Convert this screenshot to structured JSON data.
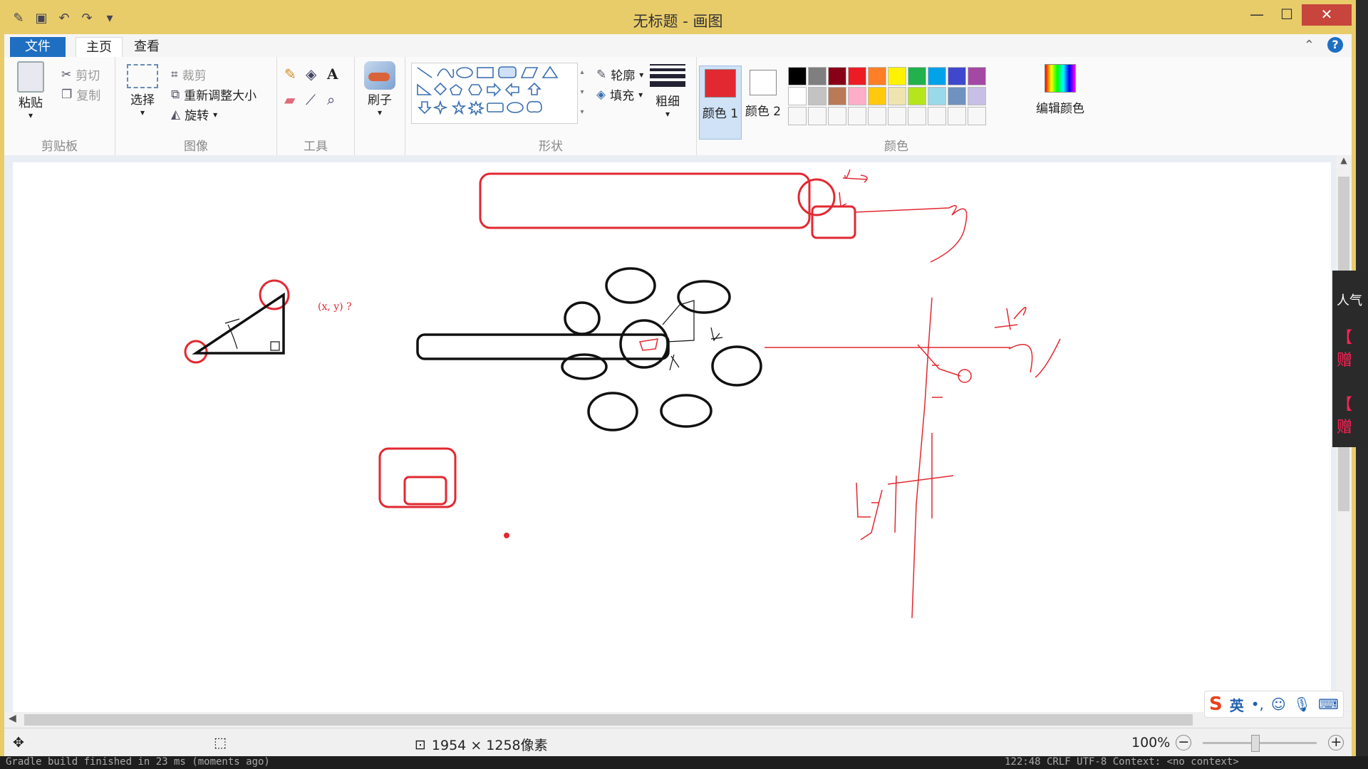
{
  "window": {
    "title": "无标题 - 画图"
  },
  "tabs": {
    "file": "文件",
    "home": "主页",
    "view": "查看"
  },
  "ribbon": {
    "clipboard": {
      "paste": "粘贴",
      "cut": "剪切",
      "copy": "复制",
      "label": "剪贴板"
    },
    "image": {
      "select": "选择",
      "crop": "裁剪",
      "resize": "重新调整大小",
      "rotate": "旋转",
      "label": "图像"
    },
    "tools": {
      "label": "工具",
      "text_tool": "A"
    },
    "brush": {
      "label": "刷子"
    },
    "shapes": {
      "outline": "轮廓",
      "fill": "填充",
      "label": "形状"
    },
    "size": {
      "label": "粗细"
    },
    "colors": {
      "color1": "颜色 1",
      "color2": "颜色 2",
      "edit": "编辑颜色",
      "label": "颜色",
      "color1_value": "#e22831",
      "color2_value": "#ffffff",
      "palette_row1": [
        "#000000",
        "#7f7f7f",
        "#880015",
        "#ed1c24",
        "#ff7f27",
        "#fff200",
        "#22b14c",
        "#00a2e8",
        "#3f48cc",
        "#a349a4"
      ],
      "palette_row2": [
        "#ffffff",
        "#c3c3c3",
        "#b97a57",
        "#ffaec9",
        "#ffc90e",
        "#efe4b0",
        "#b5e61d",
        "#99d9ea",
        "#7092be",
        "#c8bfe7"
      ]
    }
  },
  "canvas": {
    "annotation": "(x, y) ?"
  },
  "status": {
    "dimensions": "1954 × 1258像素",
    "zoom": "100%"
  },
  "side_panel": {
    "line1": "人气",
    "line2": "【",
    "line3": "赠",
    "line4": "【",
    "line5": "赠"
  },
  "ime": {
    "lang": "英"
  },
  "terminal": {
    "left": "Gradle build finished in 23 ms (moments ago)",
    "right": "122:48  CRLF  UTF-8  Context: <no context>"
  }
}
